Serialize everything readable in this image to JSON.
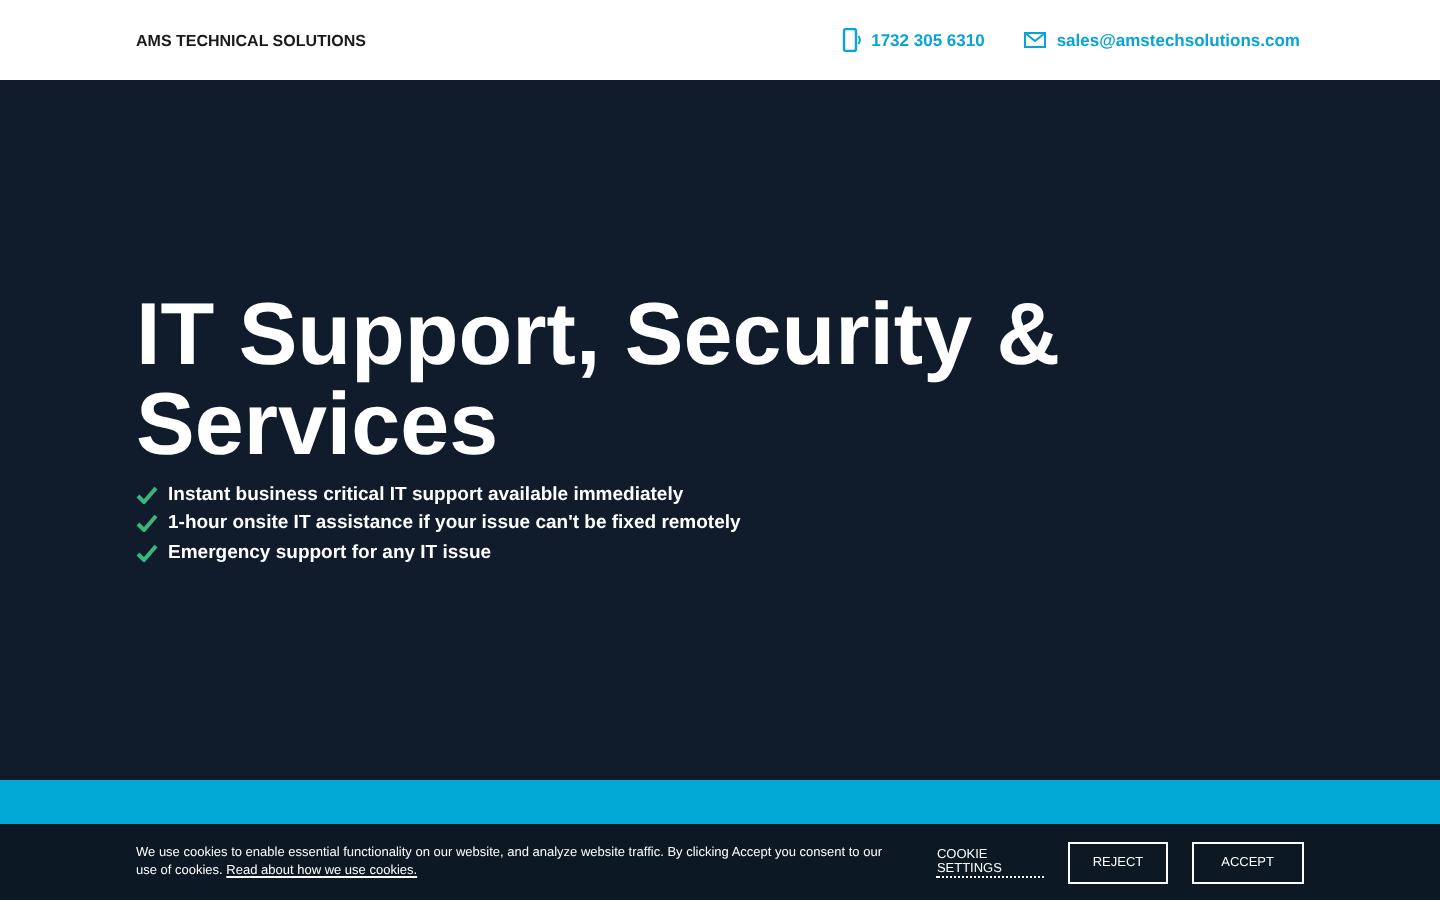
{
  "header": {
    "brand": "AMS TECHNICAL SOLUTIONS",
    "phone": "1732 305 6310",
    "email": "sales@amstechsolutions.com"
  },
  "hero": {
    "title": "IT Support, Security & Services",
    "points": [
      "Instant business critical IT support available immediately",
      "1-hour onsite IT assistance if your issue can't be fixed remotely",
      "Emergency support for any IT issue"
    ]
  },
  "cookie_bar": {
    "text": "We use cookies to enable essential functionality on our website, and analyze website traffic. By clicking Accept you consent to our use of cookies.",
    "link": "Read about how we use cookies.",
    "settings": "COOKIE SETTINGS",
    "buttons": [
      "REJECT",
      "ACCEPT"
    ]
  }
}
